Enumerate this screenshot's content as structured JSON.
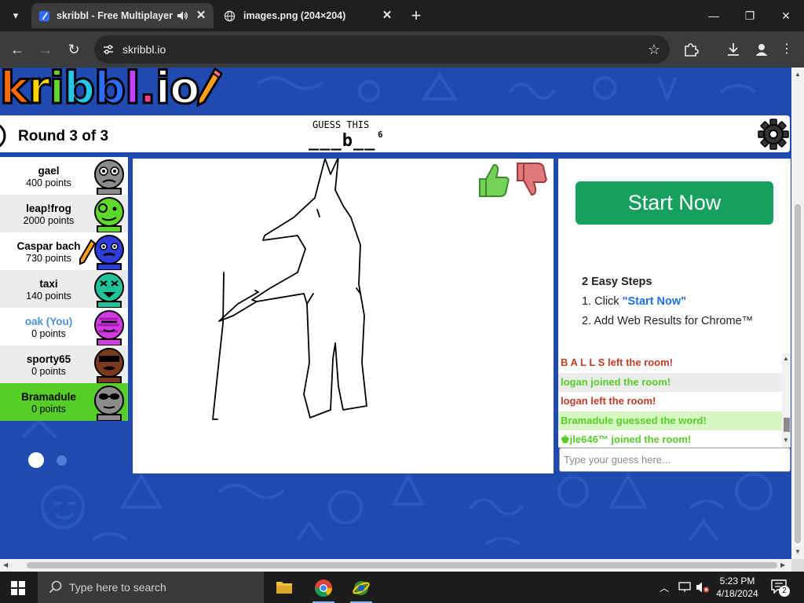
{
  "browser": {
    "tabs": [
      {
        "title": "skribbl - Free Multiplayer D",
        "active": true
      },
      {
        "title": "images.png (204×204)",
        "active": false
      }
    ],
    "url": "skribbl.io"
  },
  "game": {
    "logo": {
      "letters": [
        "k",
        "r",
        "i",
        "b",
        "b",
        "l",
        ".",
        "i",
        "o"
      ],
      "colors": [
        "#ff6a00",
        "#ffd400",
        "#5cd92a",
        "#24c7e8",
        "#2f6bff",
        "#c341ff",
        "#ff3d8b",
        "#ffffff",
        "#ffffff"
      ]
    },
    "round": "Round 3 of 3",
    "guess_label": "GUESS THIS",
    "word_hint": "___b__",
    "word_length": "6",
    "players": [
      {
        "name": "gael",
        "points": "400 points",
        "color": "#8c8c8c"
      },
      {
        "name": "leap!frog",
        "points": "2000 points",
        "color": "#5cd92a"
      },
      {
        "name": "Caspar bach",
        "points": "730 points",
        "color": "#2f3ddc"
      },
      {
        "name": "taxi",
        "points": "140 points",
        "color": "#21c29a"
      },
      {
        "name": "oak (You)",
        "points": "0 points",
        "color": "#d43ae0"
      },
      {
        "name": "sporty65",
        "points": "0 points",
        "color": "#7a3b1c"
      },
      {
        "name": "Bramadule",
        "points": "0 points",
        "color": "#8c8c8c"
      }
    ]
  },
  "ad": {
    "cta": "Start Now",
    "title": "2 Easy Steps",
    "step1_prefix": "1. Click ",
    "step1_link": "\"Start Now\"",
    "step2": "2. Add Web Results for Chrome™"
  },
  "chat": {
    "messages": [
      {
        "text": "B A L L S left the room!"
      },
      {
        "text": "logan joined the room!"
      },
      {
        "text": "logan left the room!"
      },
      {
        "text": "Bramadule guessed the word!"
      },
      {
        "text": "jle646™ joined the room!"
      }
    ],
    "input_placeholder": "Type your guess here..."
  },
  "taskbar": {
    "search_placeholder": "Type here to search",
    "time": "5:23 PM",
    "date": "4/18/2024",
    "notifications": "2"
  }
}
